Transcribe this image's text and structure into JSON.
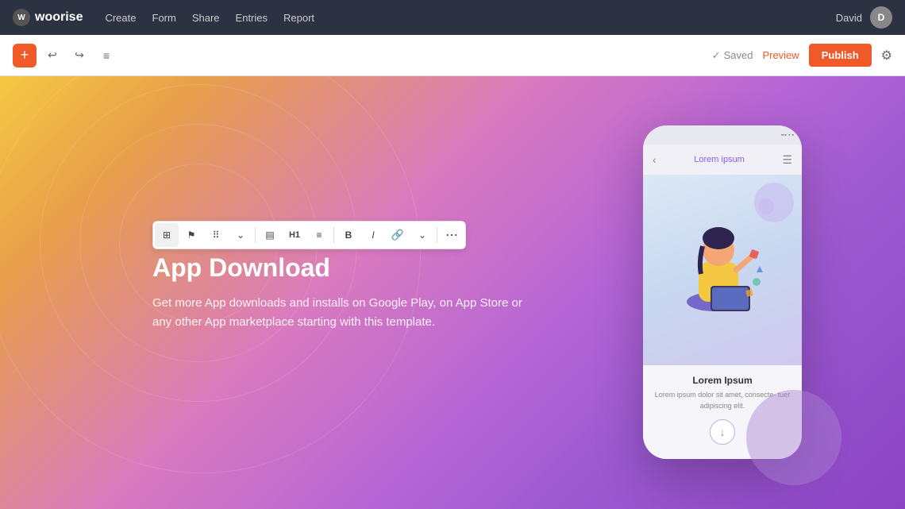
{
  "app": {
    "logo_text": "woorise",
    "logo_icon": "W"
  },
  "topnav": {
    "items": [
      {
        "label": "Create",
        "id": "create"
      },
      {
        "label": "Form",
        "id": "form"
      },
      {
        "label": "Share",
        "id": "share"
      },
      {
        "label": "Entries",
        "id": "entries"
      },
      {
        "label": "Report",
        "id": "report"
      }
    ],
    "user_name": "David"
  },
  "toolbar": {
    "add_label": "+",
    "undo_label": "↩",
    "redo_label": "↪",
    "list_label": "≡",
    "saved_label": "Saved",
    "preview_label": "Preview",
    "publish_label": "Publish",
    "settings_label": "⚙"
  },
  "block_toolbar": {
    "tools": [
      {
        "id": "grid",
        "icon": "⊞",
        "active": true
      },
      {
        "id": "flag",
        "icon": "⚑"
      },
      {
        "id": "move",
        "icon": "⠿"
      },
      {
        "id": "chevron",
        "icon": "⌄"
      },
      {
        "id": "separator1"
      },
      {
        "id": "layout",
        "icon": "▤"
      },
      {
        "id": "heading",
        "icon": "H1"
      },
      {
        "id": "align",
        "icon": "≡"
      },
      {
        "id": "separator2"
      },
      {
        "id": "bold",
        "icon": "B"
      },
      {
        "id": "italic",
        "icon": "I"
      },
      {
        "id": "link",
        "icon": "🔗"
      },
      {
        "id": "more-chevron",
        "icon": "⌄"
      },
      {
        "id": "separator3"
      },
      {
        "id": "more",
        "icon": "⋯"
      }
    ]
  },
  "content": {
    "title": "App Download",
    "description": "Get more App downloads and installs on Google Play, on App Store or any other App marketplace starting with this template."
  },
  "phone": {
    "status_icons": "▪ ▪ ▪",
    "nav_title": "Lorem ipsum",
    "content_title": "Lorem Ipsum",
    "content_text": "Lorem ipsum dolor sit amet, consecte-\ntuer adipiscing elit."
  }
}
